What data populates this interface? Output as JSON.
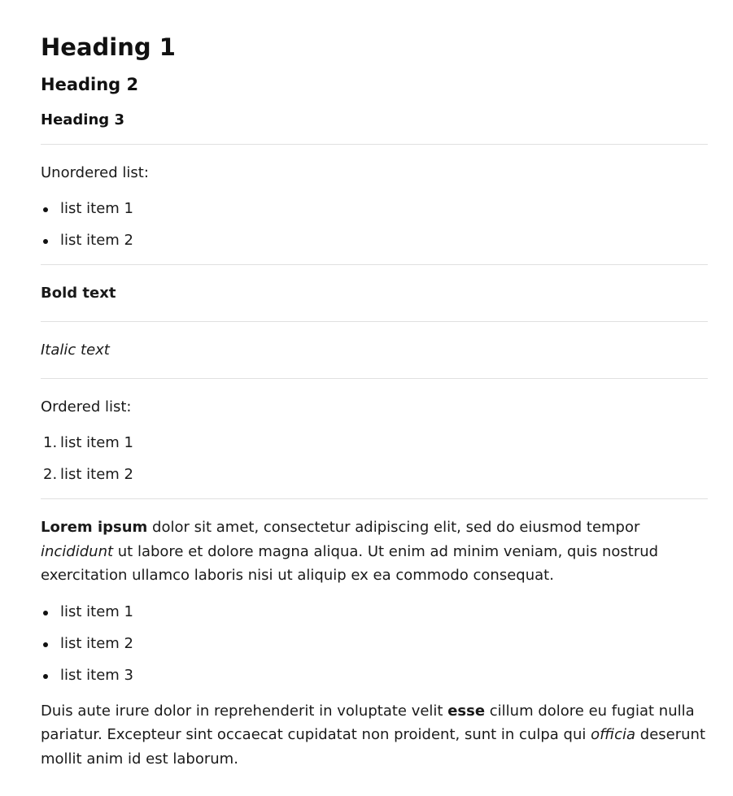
{
  "headings": {
    "h1": "Heading 1",
    "h2": "Heading 2",
    "h3": "Heading 3"
  },
  "unordered_section": {
    "label": "Unordered list:",
    "items": [
      "list item 1",
      "list item 2"
    ]
  },
  "bold_text": "Bold text",
  "italic_text": "Italic text",
  "ordered_section": {
    "label": "Ordered list:",
    "markers": [
      "1.",
      "2."
    ],
    "items": [
      "list item 1",
      "list item 2"
    ]
  },
  "paragraph1": {
    "bold_start": "Lorem ipsum",
    "text_a": " dolor sit amet, consectetur adipiscing elit, sed do eiusmod tempor ",
    "italic": "incididunt",
    "text_b": " ut labore et dolore magna aliqua. Ut enim ad minim veniam, quis nostrud exercitation ullamco laboris nisi ut aliquip ex ea commodo consequat."
  },
  "list2": {
    "items": [
      "list item 1",
      "list item 2",
      "list item 3"
    ]
  },
  "paragraph2": {
    "text_a": "Duis aute irure dolor in reprehenderit in voluptate velit ",
    "bold": "esse",
    "text_b": " cillum dolore eu fugiat nulla pariatur. Excepteur sint occaecat cupidatat non proident, sunt in culpa qui ",
    "italic": "officia",
    "text_c": " deserunt mollit anim id est laborum."
  }
}
